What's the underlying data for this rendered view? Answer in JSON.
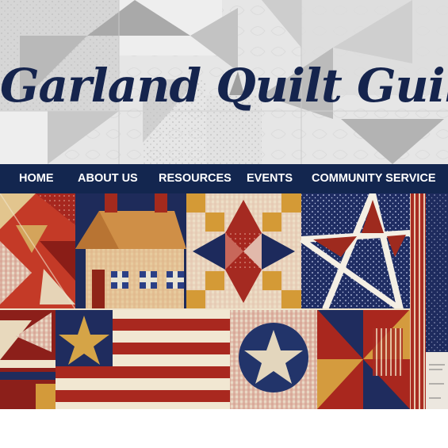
{
  "site": {
    "title": "Garland Quilt Guild"
  },
  "nav": {
    "items": [
      {
        "label": "HOME"
      },
      {
        "label": "ABOUT US"
      },
      {
        "label": "RESOURCES"
      },
      {
        "label": "EVENTS"
      },
      {
        "label": "COMMUNITY SERVICE"
      }
    ]
  },
  "colors": {
    "nav_background": "#13264f",
    "title_color": "#15244d",
    "quilt_red": "#9b231c",
    "quilt_navy": "#1c2b5e",
    "quilt_cream": "#efe3c8",
    "quilt_gold": "#d39a3a"
  }
}
